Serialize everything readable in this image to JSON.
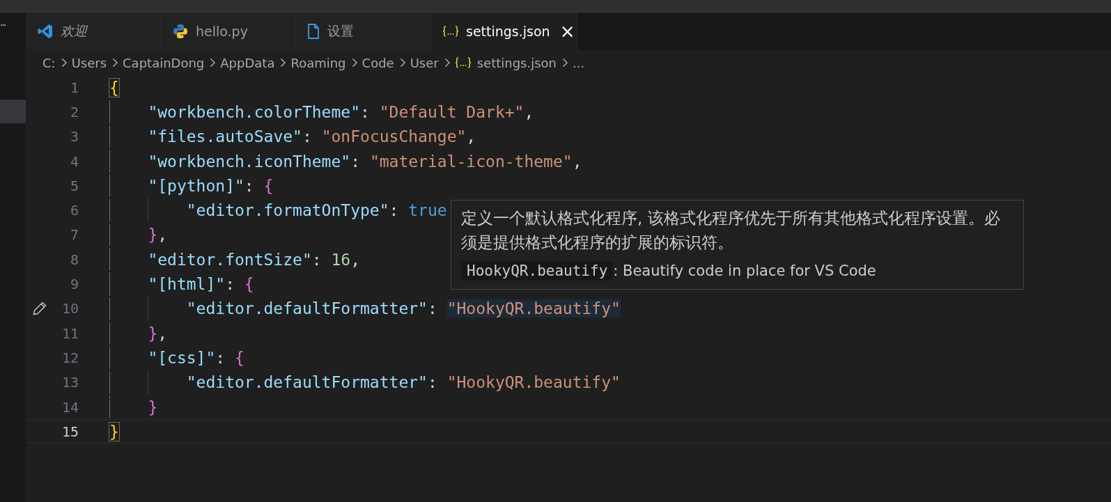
{
  "activity_bar": {
    "more": "···"
  },
  "tabs": [
    {
      "label": "欢迎",
      "kind": "vscode",
      "preview": true,
      "selected": false
    },
    {
      "label": "hello.py",
      "kind": "python",
      "preview": false,
      "selected": false
    },
    {
      "label": "设置",
      "kind": "file",
      "preview": false,
      "selected": false
    },
    {
      "label": "settings.json",
      "kind": "json",
      "preview": false,
      "selected": true,
      "close": "×"
    }
  ],
  "breadcrumbs": [
    {
      "label": "C:",
      "kind": "folder"
    },
    {
      "label": "Users",
      "kind": "folder"
    },
    {
      "label": "CaptainDong",
      "kind": "folder"
    },
    {
      "label": "AppData",
      "kind": "folder"
    },
    {
      "label": "Roaming",
      "kind": "folder"
    },
    {
      "label": "Code",
      "kind": "folder"
    },
    {
      "label": "User",
      "kind": "folder"
    },
    {
      "label": "settings.json",
      "kind": "json"
    },
    {
      "label": "...",
      "kind": "more"
    }
  ],
  "lines": [
    {
      "number": "1",
      "kind": "root",
      "current": false,
      "editing": false,
      "tokens": [
        {
          "kind": "bracket",
          "text": "{",
          "color": "#ffd700",
          "matched": true
        }
      ]
    },
    {
      "number": "2",
      "kind": "member",
      "current": false,
      "editing": false,
      "tokens": [
        {
          "kind": "key",
          "text": "\"workbench.colorTheme\""
        },
        {
          "kind": "punct",
          "text": ": "
        },
        {
          "kind": "string",
          "text": "\"Default Dark+\""
        },
        {
          "kind": "punct",
          "text": ","
        }
      ]
    },
    {
      "number": "3",
      "kind": "member",
      "current": false,
      "editing": false,
      "tokens": [
        {
          "kind": "key",
          "text": "\"files.autoSave\""
        },
        {
          "kind": "punct",
          "text": ": "
        },
        {
          "kind": "string",
          "text": "\"onFocusChange\""
        },
        {
          "kind": "punct",
          "text": ","
        }
      ]
    },
    {
      "number": "4",
      "kind": "member",
      "current": false,
      "editing": false,
      "tokens": [
        {
          "kind": "key",
          "text": "\"workbench.iconTheme\""
        },
        {
          "kind": "punct",
          "text": ": "
        },
        {
          "kind": "string",
          "text": "\"material-icon-theme\""
        },
        {
          "kind": "punct",
          "text": ","
        }
      ]
    },
    {
      "number": "5",
      "kind": "member",
      "current": false,
      "editing": false,
      "tokens": [
        {
          "kind": "key",
          "text": "\"[python]\""
        },
        {
          "kind": "punct",
          "text": ": "
        },
        {
          "kind": "bracket",
          "text": "{",
          "color": "#da70d6",
          "matched": false
        }
      ]
    },
    {
      "number": "6",
      "kind": "nested",
      "current": false,
      "editing": false,
      "tokens": [
        {
          "kind": "key",
          "text": "\"editor.formatOnType\""
        },
        {
          "kind": "punct",
          "text": ": "
        },
        {
          "kind": "boolean",
          "text": "true"
        }
      ]
    },
    {
      "number": "7",
      "kind": "member",
      "current": false,
      "editing": false,
      "tokens": [
        {
          "kind": "bracket",
          "text": "}",
          "color": "#da70d6",
          "matched": false
        },
        {
          "kind": "punct",
          "text": ","
        }
      ]
    },
    {
      "number": "8",
      "kind": "member",
      "current": false,
      "editing": false,
      "tokens": [
        {
          "kind": "key",
          "text": "\"editor.fontSize\""
        },
        {
          "kind": "punct",
          "text": ": "
        },
        {
          "kind": "number",
          "text": "16"
        },
        {
          "kind": "punct",
          "text": ","
        }
      ]
    },
    {
      "number": "9",
      "kind": "member",
      "current": false,
      "editing": false,
      "tokens": [
        {
          "kind": "key",
          "text": "\"[html]\""
        },
        {
          "kind": "punct",
          "text": ": "
        },
        {
          "kind": "bracket",
          "text": "{",
          "color": "#da70d6",
          "matched": false
        }
      ]
    },
    {
      "number": "10",
      "kind": "nested",
      "current": false,
      "editing": true,
      "tokens": [
        {
          "kind": "key",
          "text": "\"editor.defaultFormatter\""
        },
        {
          "kind": "punct",
          "text": ": "
        },
        {
          "kind": "string",
          "text": "\"HookyQR.beautify\"",
          "highlighted": true
        }
      ]
    },
    {
      "number": "11",
      "kind": "member",
      "current": false,
      "editing": false,
      "tokens": [
        {
          "kind": "bracket",
          "text": "}",
          "color": "#da70d6",
          "matched": false
        },
        {
          "kind": "punct",
          "text": ","
        }
      ]
    },
    {
      "number": "12",
      "kind": "member",
      "current": false,
      "editing": false,
      "tokens": [
        {
          "kind": "key",
          "text": "\"[css]\""
        },
        {
          "kind": "punct",
          "text": ": "
        },
        {
          "kind": "bracket",
          "text": "{",
          "color": "#da70d6",
          "matched": false
        }
      ]
    },
    {
      "number": "13",
      "kind": "nested",
      "current": false,
      "editing": false,
      "tokens": [
        {
          "kind": "key",
          "text": "\"editor.defaultFormatter\""
        },
        {
          "kind": "punct",
          "text": ": "
        },
        {
          "kind": "string",
          "text": "\"HookyQR.beautify\""
        }
      ]
    },
    {
      "number": "14",
      "kind": "member",
      "current": false,
      "editing": false,
      "tokens": [
        {
          "kind": "bracket",
          "text": "}",
          "color": "#da70d6",
          "matched": false
        }
      ]
    },
    {
      "number": "15",
      "kind": "root",
      "current": true,
      "editing": false,
      "tokens": [
        {
          "kind": "bracket",
          "text": "}",
          "color": "#ffd700",
          "matched": true
        }
      ]
    }
  ],
  "hover": {
    "description": "定义一个默认格式化程序, 该格式化程序优先于所有其他格式化程序设置。必须是提供格式化程序的扩展的标识符。",
    "value": "HookyQR.beautify",
    "value_description": ": Beautify code in place for VS Code"
  }
}
